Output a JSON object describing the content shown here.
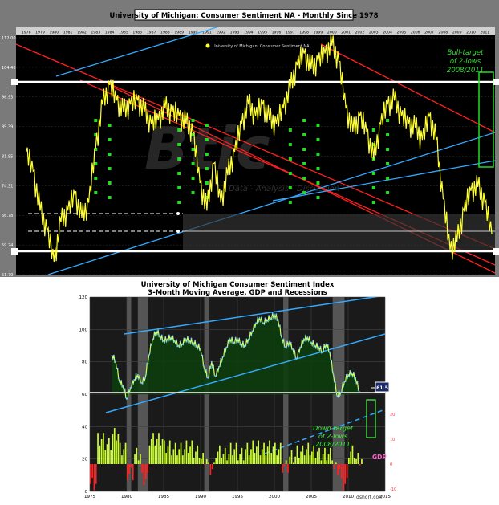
{
  "top_chart": {
    "title": "University of Michigan: Consumer Sentiment NA - Monthly Since 1978",
    "legend_label": "University of Michigan: Consumer Sentiment NA",
    "watermark_big": "Btic",
    "watermark_small": "Data - Analysis - Discussion",
    "annotation": [
      "Bull-target",
      "of 2-lows",
      "2008/2011"
    ],
    "x_tick_labels": [
      "1978",
      "1979",
      "1980",
      "1981",
      "1982",
      "1983",
      "1984",
      "1985",
      "1986",
      "1987",
      "1988",
      "1989",
      "1990",
      "1991",
      "1992",
      "1993",
      "1994",
      "1995",
      "1996",
      "1997",
      "1998",
      "1999",
      "2000",
      "2001",
      "2002",
      "2003",
      "2004",
      "2005",
      "2006",
      "2007",
      "2008",
      "2009",
      "2010",
      "2011"
    ],
    "y_tick_labels": [
      "112.00",
      "104.46",
      "96.93",
      "89.39",
      "81.85",
      "74.31",
      "66.78",
      "59.24",
      "51.70"
    ],
    "colors": {
      "background": "#000000",
      "series": "#ffff33",
      "red_lines": "#ff2020",
      "blue_lines": "#33aaff",
      "white_lines": "#ffffff",
      "markers": "#22dd22"
    }
  },
  "bottom_chart": {
    "title_line1": "University of Michigan Consumer Sentiment Index",
    "title_line2": "3-Month Moving Average, GDP and Recessions",
    "value_badge": "61.5",
    "annotation": [
      "Down-target",
      "of 2-lows",
      "2008/2011"
    ],
    "gdp_label": "GDP",
    "source_label": "dshort.com",
    "x_tick_labels": [
      "1975",
      "1980",
      "1985",
      "1990",
      "1995",
      "2000",
      "2005",
      "2010",
      "2015"
    ],
    "y_tick_labels": [
      "120",
      "100",
      "80",
      "60",
      "40",
      "20",
      "0"
    ],
    "gdp_tick_labels": [
      "20",
      "10",
      "0",
      "-10"
    ],
    "colors": {
      "background": "#ffffff",
      "series": "#ccff66",
      "area_fill": "#0d3d0d",
      "recession": "#555555",
      "blue_lines": "#33aaff",
      "gdp_pos": "#ccff33",
      "gdp_neg": "#ff2222",
      "gdp_label": "#ff66cc",
      "annotation": "#44ee44"
    }
  },
  "chart_data": [
    {
      "type": "line",
      "title": "University of Michigan: Consumer Sentiment NA - Monthly Since 1978",
      "series": [
        {
          "name": "University of Michigan: Consumer Sentiment NA",
          "x": [
            1978.0,
            1978.5,
            1979.0,
            1979.5,
            1980.0,
            1980.5,
            1981.0,
            1981.5,
            1982.0,
            1982.5,
            1983.0,
            1983.5,
            1984.0,
            1984.5,
            1985.0,
            1985.5,
            1986.0,
            1986.5,
            1987.0,
            1987.5,
            1988.0,
            1988.5,
            1989.0,
            1989.5,
            1990.0,
            1990.5,
            1991.0,
            1991.5,
            1992.0,
            1992.5,
            1993.0,
            1993.5,
            1994.0,
            1994.5,
            1995.0,
            1995.5,
            1996.0,
            1996.5,
            1997.0,
            1997.5,
            1998.0,
            1998.5,
            1999.0,
            1999.5,
            2000.0,
            2000.5,
            2001.0,
            2001.5,
            2002.0,
            2002.5,
            2003.0,
            2003.5,
            2004.0,
            2004.5,
            2005.0,
            2005.5,
            2006.0,
            2006.5,
            2007.0,
            2007.5,
            2008.0,
            2008.5,
            2009.0,
            2009.5,
            2010.0,
            2010.5,
            2011.0,
            2011.5
          ],
          "values": [
            83,
            78,
            68,
            63,
            55,
            65,
            68,
            72,
            66,
            70,
            84,
            95,
            100,
            96,
            93,
            95,
            96,
            93,
            90,
            91,
            94,
            93,
            92,
            90,
            88,
            75,
            68,
            80,
            70,
            77,
            83,
            90,
            95,
            92,
            95,
            91,
            90,
            94,
            99,
            105,
            108,
            104,
            106,
            108,
            110,
            106,
            94,
            88,
            92,
            88,
            81,
            90,
            95,
            96,
            92,
            90,
            89,
            86,
            92,
            86,
            71,
            58,
            60,
            68,
            73,
            74,
            70,
            62
          ]
        }
      ],
      "ylim": [
        51.7,
        112.0
      ],
      "xlim": [
        1978,
        2011
      ]
    },
    {
      "type": "line",
      "title": "University of Michigan Consumer Sentiment Index 3-Month Moving Average, GDP and Recessions",
      "series": [
        {
          "x": [
            1978.0,
            1978.5,
            1979.0,
            1979.5,
            1980.0,
            1980.5,
            1981.0,
            1981.5,
            1982.0,
            1982.5,
            1983.0,
            1983.5,
            1984.0,
            1984.5,
            1985.0,
            1985.5,
            1986.0,
            1986.5,
            1987.0,
            1987.5,
            1988.0,
            1988.5,
            1989.0,
            1989.5,
            1990.0,
            1990.5,
            1991.0,
            1991.5,
            1992.0,
            1992.5,
            1993.0,
            1993.5,
            1994.0,
            1994.5,
            1995.0,
            1995.5,
            1996.0,
            1996.5,
            1997.0,
            1997.5,
            1998.0,
            1998.5,
            1999.0,
            1999.5,
            2000.0,
            2000.5,
            2001.0,
            2001.5,
            2002.0,
            2002.5,
            2003.0,
            2003.5,
            2004.0,
            2004.5,
            2005.0,
            2005.5,
            2006.0,
            2006.5,
            2007.0,
            2007.5,
            2008.0,
            2008.5,
            2009.0,
            2009.5,
            2010.0,
            2010.5,
            2011.0,
            2011.5
          ],
          "values": [
            84,
            80,
            68,
            65,
            57,
            64,
            69,
            72,
            67,
            70,
            84,
            94,
            99,
            96,
            93,
            94,
            95,
            93,
            90,
            91,
            94,
            93,
            92,
            90,
            88,
            76,
            70,
            80,
            71,
            77,
            83,
            89,
            94,
            92,
            94,
            91,
            90,
            94,
            99,
            104,
            107,
            104,
            106,
            107,
            109,
            106,
            95,
            89,
            92,
            88,
            82,
            89,
            94,
            95,
            92,
            90,
            89,
            86,
            91,
            86,
            72,
            59,
            61,
            68,
            72,
            73,
            70,
            61.5
          ]
        },
        {
          "name": "GDP",
          "x": [
            1975,
            1976,
            1977,
            1978,
            1979,
            1980,
            1981,
            1982,
            1983,
            1984,
            1985,
            1986,
            1987,
            1988,
            1989,
            1990,
            1991,
            1992,
            1993,
            1994,
            1995,
            1996,
            1997,
            1998,
            1999,
            2000,
            2001,
            2002,
            2003,
            2004,
            2005,
            2006,
            2007,
            2008,
            2009,
            2010,
            2011
          ],
          "values": [
            -8,
            10,
            8,
            12,
            6,
            -4,
            4,
            -6,
            10,
            10,
            7,
            6,
            6,
            7,
            5,
            2,
            -2,
            5,
            4,
            6,
            4,
            6,
            7,
            6,
            7,
            6,
            -1,
            3,
            5,
            6,
            5,
            4,
            4,
            -2,
            -8,
            5,
            2
          ]
        }
      ],
      "ylim": [
        0,
        120
      ],
      "xlim": [
        1975,
        2015
      ]
    }
  ]
}
